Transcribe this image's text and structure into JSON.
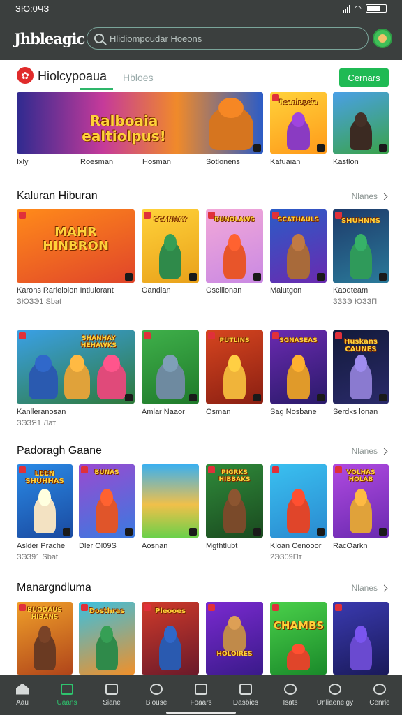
{
  "status": {
    "time": "ЗЮ:0ЧЗ"
  },
  "appbar": {
    "logo": "Jhbleagic",
    "search_placeholder": "Hlidiompoudar Hoeons"
  },
  "tabs": {
    "active": "Hiolcypoaua",
    "other": "Hbloes",
    "action": "Cernars"
  },
  "banner": {
    "title": "Ralboaia ealtiolpus!",
    "labels": [
      "Ixly",
      "Roesman",
      "Hosman",
      "Sotlonens",
      "Kafuaian",
      "Kastlon"
    ],
    "tiles": [
      "Rcanlopcia",
      "",
      ""
    ]
  },
  "section1": {
    "title": "Kaluran Hiburan",
    "more": "Nlanes",
    "row1": [
      {
        "tile": "MAHR HINBRON",
        "label": "Karons Rarleiolon Intlulorant",
        "sub": "ЗЮЗЭ1 Sbat"
      },
      {
        "tile": "SCANHAY",
        "label": "Oandlan",
        "sub": ""
      },
      {
        "tile": "BUNOLAWS",
        "label": "Oscilionan",
        "sub": ""
      },
      {
        "tile": "SCATHAULS",
        "label": "Malutgon",
        "sub": ""
      },
      {
        "tile": "SHUHNNS",
        "label": "Kaodteam",
        "sub": "ЗЗЗЭ ЮЗЗП"
      }
    ],
    "row2": [
      {
        "tile": "SHANHAY HEHAWKS",
        "label": "Kanlleranosan",
        "sub": "ЗЭЗЯ1 Лат"
      },
      {
        "tile": "",
        "label": "Amlar Naaor",
        "sub": ""
      },
      {
        "tile": "PUTLINS",
        "label": "Osman",
        "sub": ""
      },
      {
        "tile": "SGNASEAS",
        "label": "Sag Nosbane",
        "sub": ""
      },
      {
        "tile": "Huskans CAUNES",
        "label": "Serdks lonan",
        "sub": ""
      }
    ]
  },
  "section2": {
    "title": "Padoragh Gaane",
    "more": "Nlanes",
    "row": [
      {
        "tile": "LEEN SHUHHAS",
        "label": "Aslder Prache",
        "sub": "ЗЭЗ91 Sbat"
      },
      {
        "tile": "BUNAS",
        "label": "Dler Ol09S",
        "sub": ""
      },
      {
        "tile": "",
        "label": "Aosnan",
        "sub": ""
      },
      {
        "tile": "PIGRKS HIBBAKS",
        "label": "Mgfhtlubt",
        "sub": ""
      },
      {
        "tile": "",
        "label": "Kloan Cenooor",
        "sub": "2ЭЗ09Пт"
      },
      {
        "tile": "VOLHAS HOLAB",
        "label": "RacOarkn",
        "sub": ""
      }
    ]
  },
  "section3": {
    "title": "Manargndluma",
    "more": "Nlanes",
    "row": [
      {
        "tile": "BUODAUS HIBANS",
        "label": "",
        "sub": ""
      },
      {
        "tile": "Dosthras",
        "label": "",
        "sub": ""
      },
      {
        "tile": "Pleooes",
        "label": "",
        "sub": ""
      },
      {
        "tile": "HOLOIRES",
        "label": "",
        "sub": ""
      },
      {
        "tile": "CHAMBS",
        "label": "",
        "sub": ""
      },
      {
        "tile": "",
        "label": "",
        "sub": ""
      }
    ]
  },
  "nav": [
    "Aau",
    "Uaans",
    "Siane",
    "Biouse",
    "Foaars",
    "Dasbies",
    "Isats",
    "Unliaeneigy",
    "Cenrie"
  ],
  "colors": {
    "appbar": "#3b3f3e",
    "accent": "#2eb66a",
    "action": "#1fba54"
  }
}
